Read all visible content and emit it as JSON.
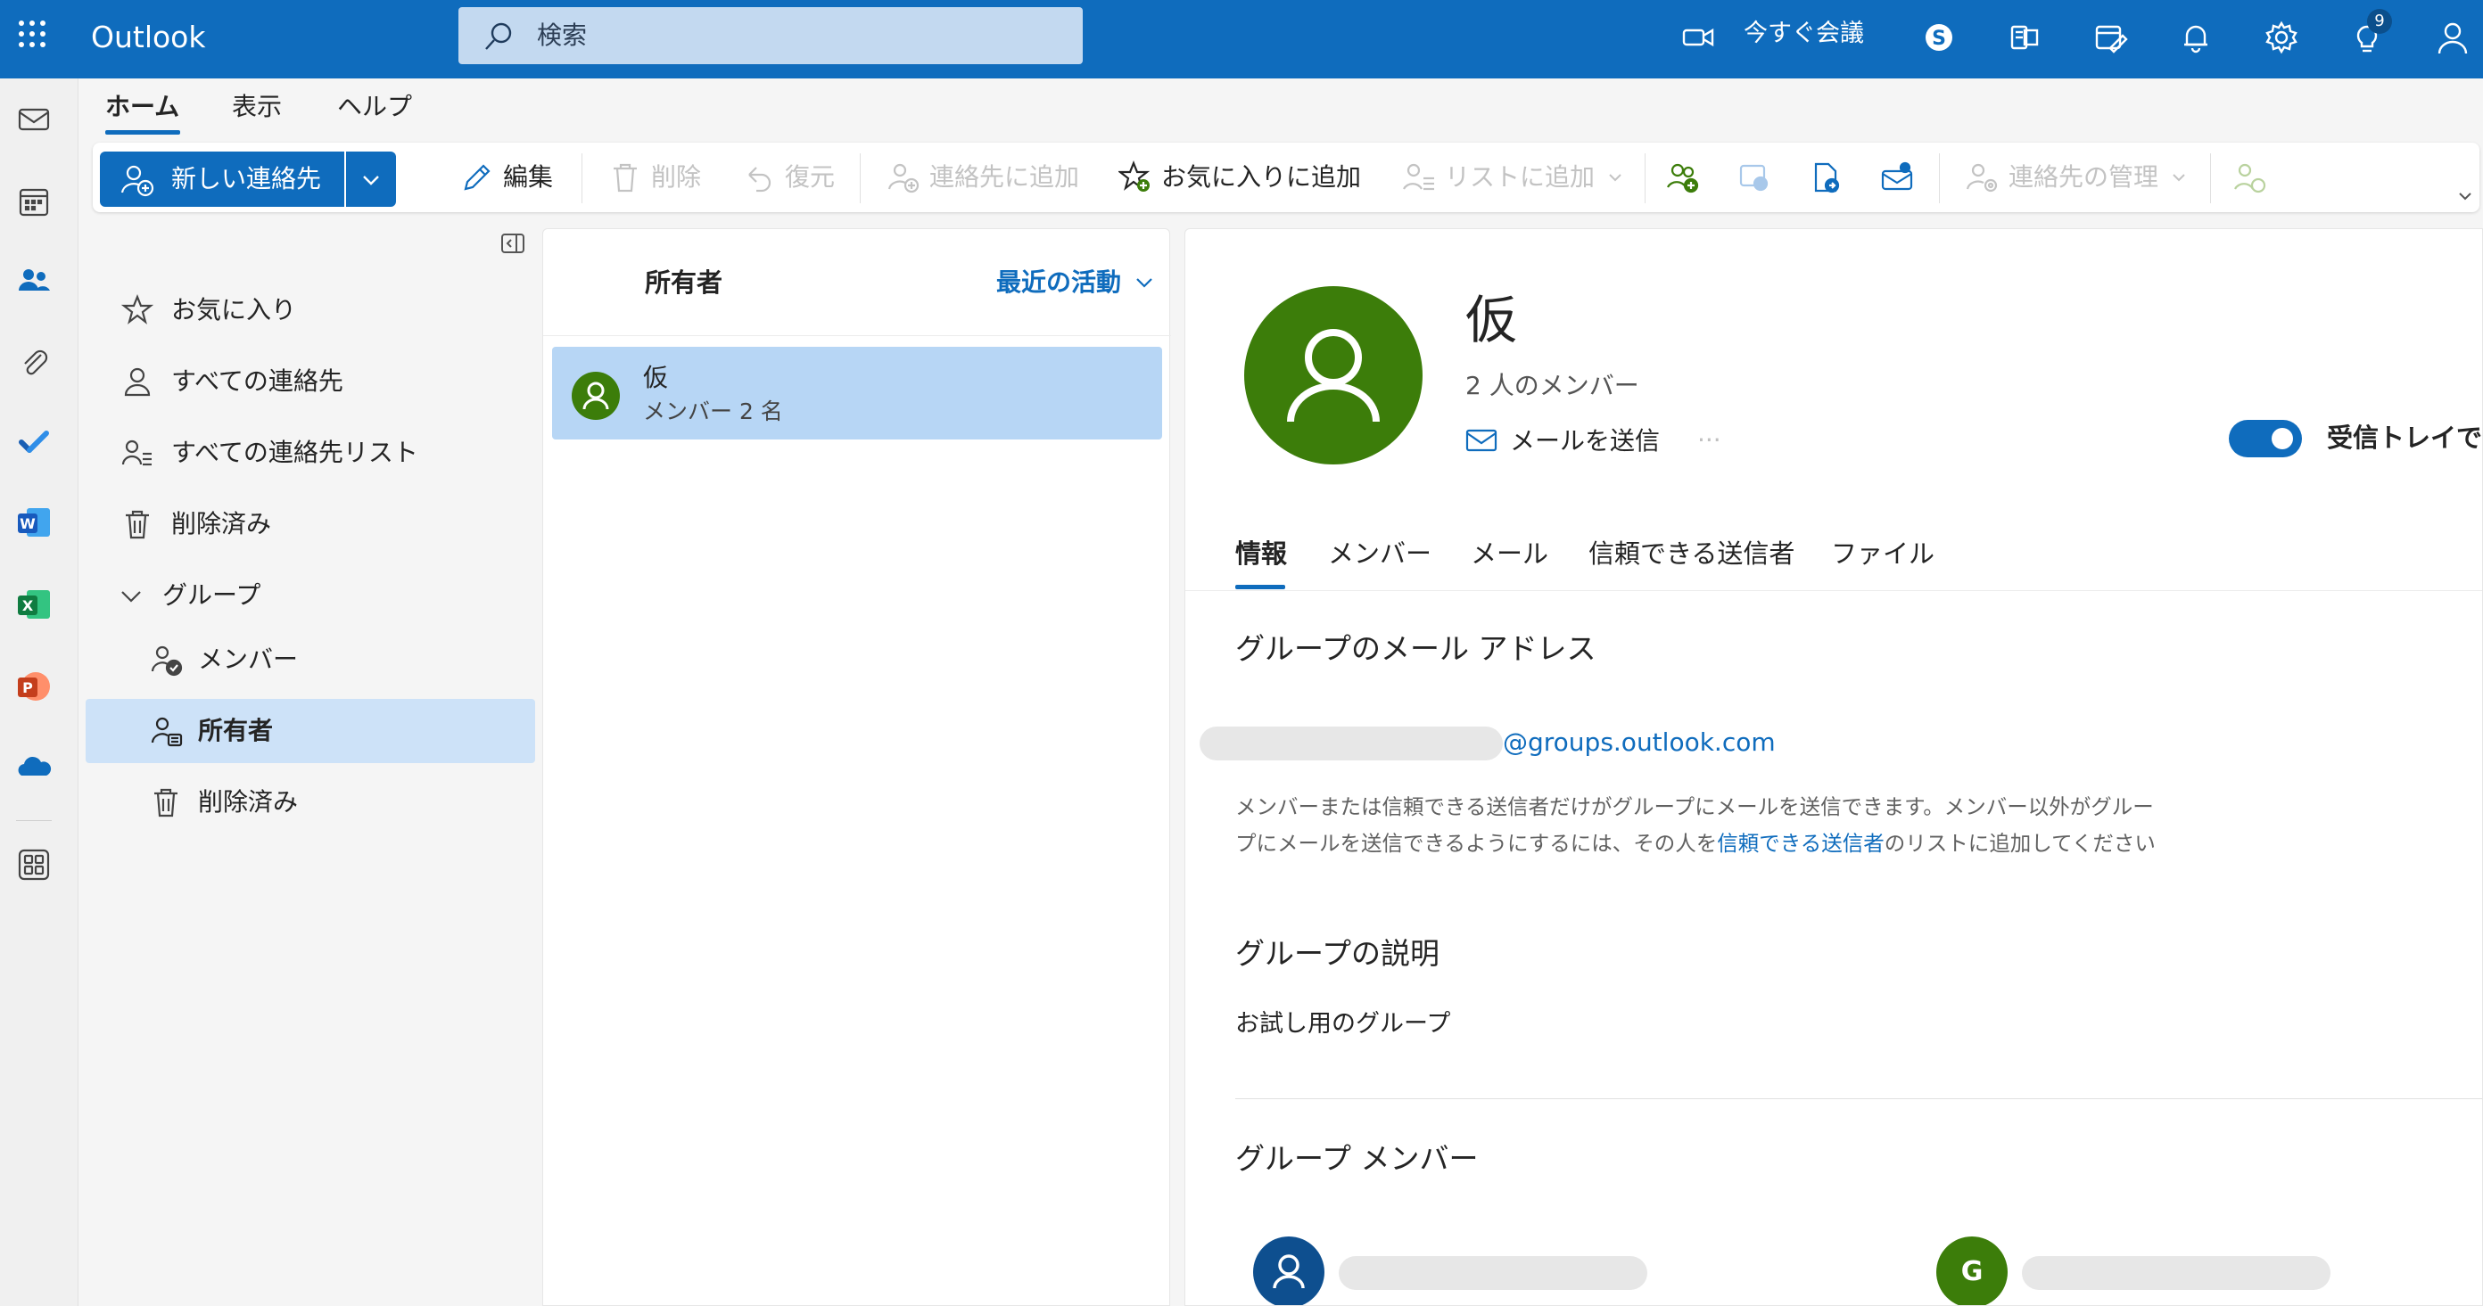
{
  "app": {
    "title": "Outlook"
  },
  "search": {
    "placeholder": "検索"
  },
  "topbar": {
    "meet_now": "今すぐ会議",
    "notifications_badge": "9"
  },
  "tabs": {
    "home": "ホーム",
    "view": "表示",
    "help": "ヘルプ"
  },
  "ribbon": {
    "new_contact": "新しい連絡先",
    "edit": "編集",
    "delete": "削除",
    "restore": "復元",
    "add_to_contacts": "連絡先に追加",
    "add_favorite": "お気に入りに追加",
    "add_to_list": "リストに追加",
    "manage_contacts": "連絡先の管理"
  },
  "folders": {
    "favorites": "お気に入り",
    "all_contacts": "すべての連絡先",
    "all_contact_lists": "すべての連絡先リスト",
    "deleted": "削除済み",
    "groups": "グループ",
    "members": "メンバー",
    "owner": "所有者",
    "groups_deleted": "削除済み"
  },
  "list": {
    "title": "所有者",
    "sort": "最近の活動",
    "items": [
      {
        "name": "仮",
        "subtitle": "メンバー 2 名"
      }
    ]
  },
  "detail": {
    "name": "仮",
    "members": "2 人のメンバー",
    "send_mail": "メールを送信",
    "inbox_toggle_label": "受信トレイで",
    "tabs": [
      "情報",
      "メンバー",
      "メール",
      "信頼できる送信者",
      "ファイル"
    ],
    "email_section_title": "グループのメール アドレス",
    "email_domain": "@groups.outlook.com",
    "note_part1": "メンバーまたは信頼できる送信者だけがグループにメールを送信できます。メンバー以外がグループにメールを送信できるようにするには、その人を",
    "note_link": "信頼できる送信者",
    "note_part2": "のリストに追加してください",
    "description_title": "グループの説明",
    "description": "お試し用のグループ",
    "members_title": "グループ メンバー",
    "member_initial": "G"
  },
  "colors": {
    "brand": "#0f6cbd",
    "avatar_green": "#3c7d0a",
    "member_blue": "#0e4f8f",
    "selected": "#cde2f8"
  }
}
